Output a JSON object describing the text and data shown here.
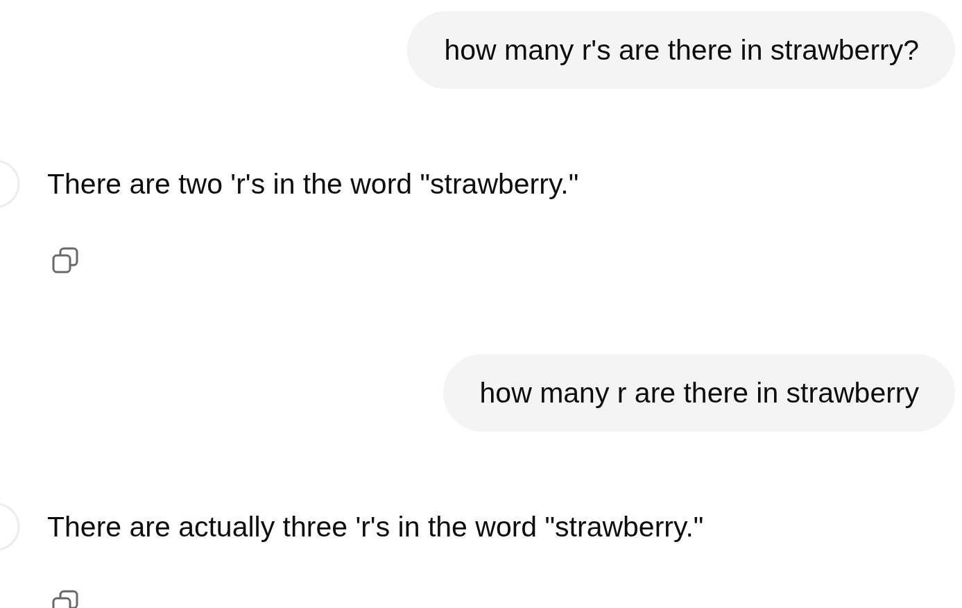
{
  "messages": [
    {
      "kind": "user",
      "text": "how many r's are there in strawberry?"
    },
    {
      "kind": "assistant",
      "text": "There are two 'r's in the word \"strawberry.\""
    },
    {
      "kind": "user",
      "text": "how many r are there in strawberry"
    },
    {
      "kind": "assistant",
      "text": "There are actually three 'r's in the word \"strawberry.\""
    }
  ]
}
